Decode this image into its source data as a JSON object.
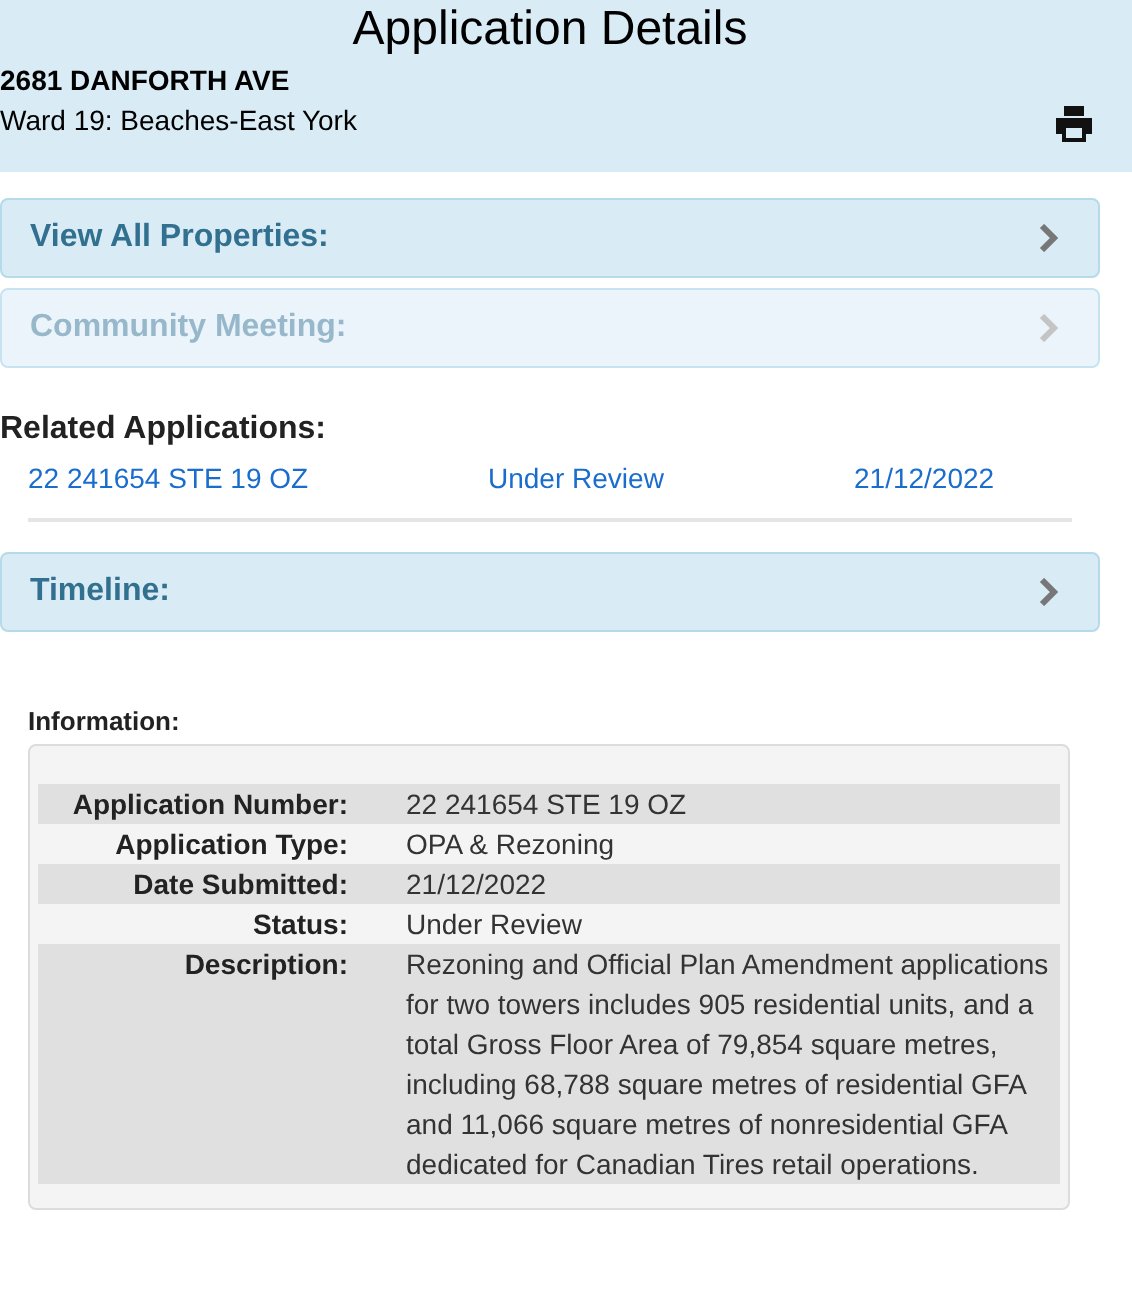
{
  "header": {
    "title": "Application Details",
    "address": "2681 DANFORTH AVE",
    "ward": "Ward 19: Beaches-East York"
  },
  "panels_top": [
    {
      "label": "View All Properties:",
      "disabled": false
    },
    {
      "label": "Community Meeting:",
      "disabled": true
    }
  ],
  "related": {
    "heading": "Related Applications:",
    "rows": [
      {
        "number": "22 241654 STE 19 OZ",
        "status": "Under Review",
        "date": "21/12/2022"
      }
    ]
  },
  "panels_bottom": [
    {
      "label": "Timeline:",
      "disabled": false
    }
  ],
  "information": {
    "heading": "Information:",
    "rows": [
      {
        "label": "Application Number:",
        "value": "22 241654 STE 19 OZ"
      },
      {
        "label": "Application Type:",
        "value": "OPA & Rezoning"
      },
      {
        "label": "Date Submitted:",
        "value": "21/12/2022"
      },
      {
        "label": "Status:",
        "value": "Under Review"
      },
      {
        "label": "Description:",
        "value": "Rezoning and Official Plan Amendment applications for two towers includes 905 residential units, and a total Gross Floor Area of 79,854 square metres, including 68,788 square metres of residential GFA and 11,066 square metres of nonresidential GFA dedicated for Canadian Tires retail operations."
      }
    ]
  }
}
